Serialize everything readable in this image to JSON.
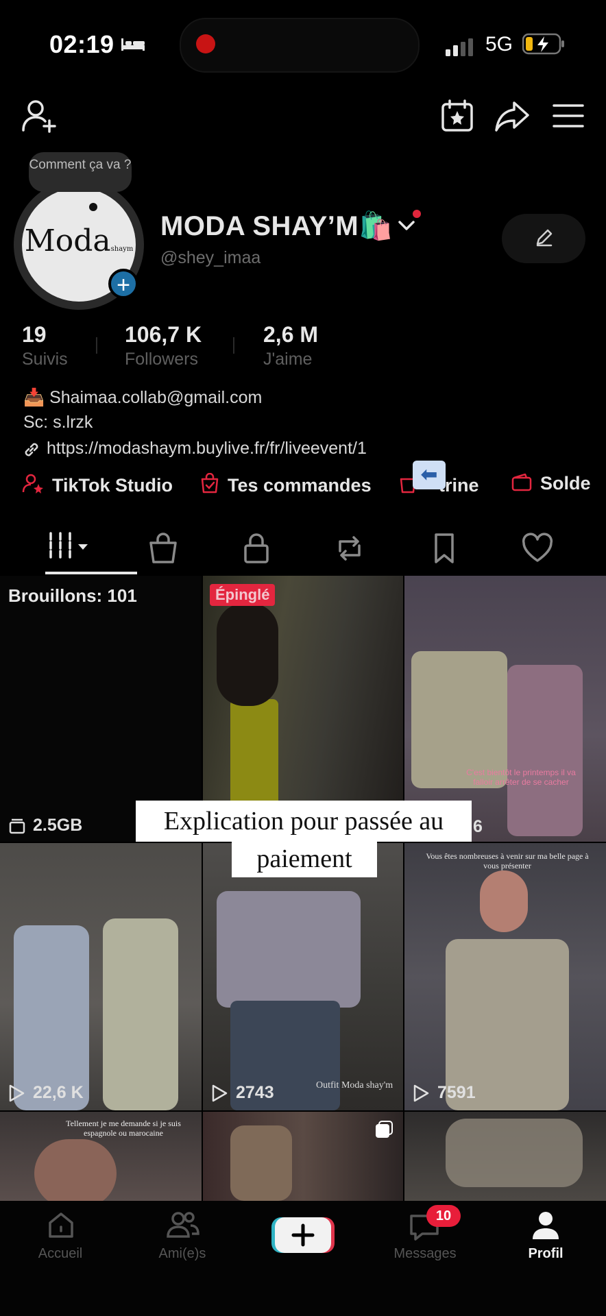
{
  "status_bar": {
    "time": "02:19",
    "network": "5G",
    "icons": [
      "bed-icon",
      "record-dot-icon",
      "signal-icon",
      "battery-charging-icon"
    ]
  },
  "header": {
    "icons": [
      "add-friend-icon",
      "calendar-star-icon",
      "share-icon",
      "menu-icon"
    ]
  },
  "profile": {
    "status_bubble": "Comment ça va ?",
    "avatar_text": "Moda",
    "avatar_subtext": "shaym",
    "display_name": "MODA SHAY’M🛍️",
    "handle": "@shey_imaa"
  },
  "stats": [
    {
      "value": "19",
      "label": "Suivis"
    },
    {
      "value": "106,7 K",
      "label": "Followers"
    },
    {
      "value": "2,6 M",
      "label": "J'aime"
    }
  ],
  "bio": {
    "email": "📥 Shaimaa.collab@gmail.com",
    "sc": "Sc: s.lrzk",
    "link": "https://modashaym.buylive.fr/fr/liveevent/1"
  },
  "quick_links": [
    {
      "label": "TikTok Studio",
      "icon": "studio-icon"
    },
    {
      "label": "Tes commandes",
      "icon": "orders-icon"
    },
    {
      "label": "trine",
      "icon": "showcase-icon"
    },
    {
      "label": "Solde",
      "icon": "wallet-icon"
    }
  ],
  "back_glyph": "⬅",
  "tabs": [
    "grid-icon",
    "shop-bag-icon",
    "lock-icon",
    "repost-icon",
    "bookmark-icon",
    "heart-icon"
  ],
  "grid": {
    "drafts_label": "Brouillons: 101",
    "drafts_size": "2.5GB",
    "pinned_label": "Épinglé",
    "partial_count": "6",
    "views": [
      "22,6 K",
      "2743",
      "7591"
    ],
    "cell_texts": {
      "c3_caption": "C'est bientôt le printemps il va falloir arrêter de se cacher",
      "c6_caption": "Vous êtes nombreuses à venir sur ma belle page à vous présenter",
      "c5_watermark": "Outfit Moda shay'm",
      "c7_caption": "Tellement je me demande si je suis espagnole ou marocaine"
    }
  },
  "overlay_caption": {
    "line1": "Explication pour passée au",
    "line2": "paiement"
  },
  "bottom_nav": {
    "items": [
      {
        "label": "Accueil",
        "icon": "home-icon"
      },
      {
        "label": "Ami(e)s",
        "icon": "friends-icon"
      },
      {
        "label": "",
        "icon": "create-plus-icon"
      },
      {
        "label": "Messages",
        "icon": "messages-icon"
      },
      {
        "label": "Profil",
        "icon": "profile-icon"
      }
    ],
    "messages_badge": "10"
  },
  "colors": {
    "background": "#000000",
    "accent_red": "#e3263f",
    "badge_blue": "#1d6fa5"
  }
}
